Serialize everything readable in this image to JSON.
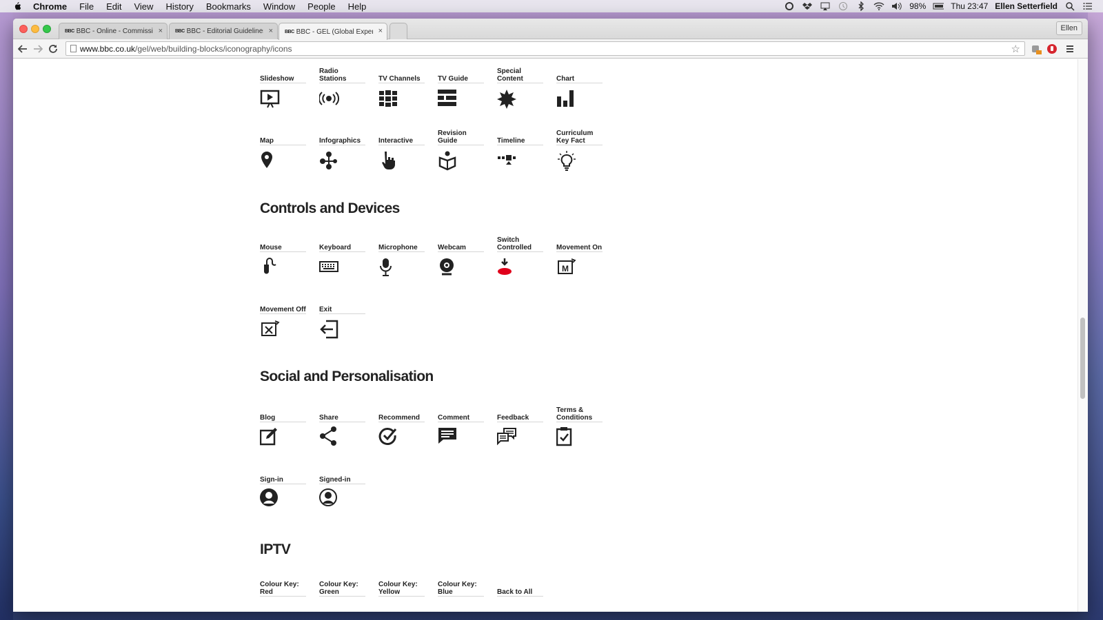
{
  "menubar": {
    "app": "Chrome",
    "items": [
      "File",
      "Edit",
      "View",
      "History",
      "Bookmarks",
      "Window",
      "People",
      "Help"
    ],
    "battery": "98%",
    "clock": "Thu 23:47",
    "user": "Ellen Setterfield"
  },
  "browser": {
    "tabs": [
      {
        "label": "BBC - Online - Commissio",
        "active": false
      },
      {
        "label": "BBC - Editorial Guidelines",
        "active": false
      },
      {
        "label": "BBC - GEL (Global Experie",
        "active": true
      }
    ],
    "profile": "Ellen",
    "url_host": "www.bbc.co.uk",
    "url_path": "/gel/web/building-blocks/iconography/icons"
  },
  "sections": {
    "controls": "Controls and Devices",
    "social": "Social and Personalisation",
    "iptv": "IPTV"
  },
  "icons": {
    "slideshow": "Slideshow",
    "radio": "Radio Stations",
    "tvchannels": "TV Channels",
    "tvguide": "TV Guide",
    "special": "Special Content",
    "chart": "Chart",
    "map": "Map",
    "infographics": "Infographics",
    "interactive": "Interactive",
    "revision": "Revision Guide",
    "timeline": "Timeline",
    "keyfact": "Curriculum Key Fact",
    "mouse": "Mouse",
    "keyboard": "Keyboard",
    "microphone": "Microphone",
    "webcam": "Webcam",
    "switch": "Switch Controlled",
    "movon": "Movement On",
    "movoff": "Movement Off",
    "exit": "Exit",
    "blog": "Blog",
    "share": "Share",
    "recommend": "Recommend",
    "comment": "Comment",
    "feedback": "Feedback",
    "terms": "Terms & Conditions",
    "signin": "Sign-in",
    "signedin": "Signed-in",
    "ck_red": "Colour Key: Red",
    "ck_green": "Colour Key: Green",
    "ck_yellow": "Colour Key: Yellow",
    "ck_blue": "Colour Key: Blue",
    "back_all": "Back to All"
  },
  "colors": {
    "switch_accent": "#e0001b",
    "text": "#222222"
  }
}
